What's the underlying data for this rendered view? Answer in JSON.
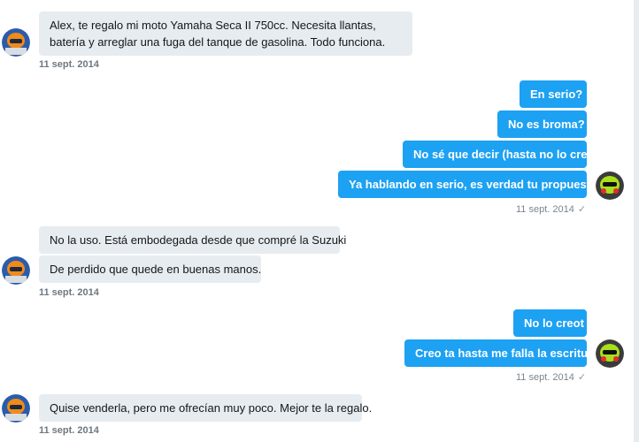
{
  "messages": [
    {
      "text": "Alex, te regalo mi moto Yamaha Seca II 750cc. Necesita llantas, batería y arreglar una fuga del tanque de gasolina. Todo funciona."
    },
    {
      "text": "En serio?"
    },
    {
      "text": "No es broma?"
    },
    {
      "text": "No sé que decir (hasta no lo creo)"
    },
    {
      "text": "Ya hablando en serio,  es verdad tu propuesta?"
    },
    {
      "text": "No la uso. Está embodegada desde que compré la Suzuki"
    },
    {
      "text": "De perdido que quede en buenas manos."
    },
    {
      "text": "No lo creot"
    },
    {
      "text": "Creo ta hasta me falla la escritura"
    },
    {
      "text": "Quise venderla, pero me ofrecían muy poco. Mejor te la regalo."
    }
  ],
  "timestamps": {
    "t1": "11 sept. 2014",
    "t2": "11 sept. 2014",
    "t3": "11 sept. 2014",
    "t4": "11 sept. 2014",
    "t5": "11 sept. 2014",
    "t6": "11 sept. 2014"
  },
  "read_mark": "✓",
  "colors": {
    "outgoing_bubble": "#1da1f2",
    "incoming_bubble": "#e6ecf0",
    "timestamp": "#7a858f"
  },
  "icons": {
    "sender_avatar": "avatar-orange-helmet",
    "self_avatar": "avatar-green-helmet"
  }
}
